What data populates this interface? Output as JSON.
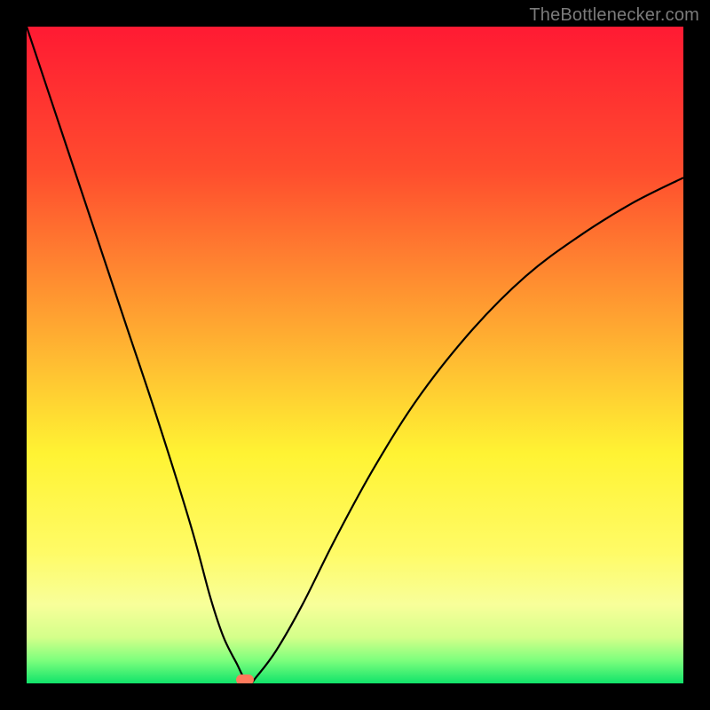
{
  "watermark": "TheBottlenecker.com",
  "chart_data": {
    "type": "line",
    "title": "",
    "xlabel": "",
    "ylabel": "",
    "xlim": [
      0,
      100
    ],
    "ylim": [
      0,
      100
    ],
    "gradient_stops": [
      {
        "offset": 0,
        "color": "#ff1a33"
      },
      {
        "offset": 0.22,
        "color": "#ff4d2e"
      },
      {
        "offset": 0.45,
        "color": "#ffa531"
      },
      {
        "offset": 0.65,
        "color": "#fff333"
      },
      {
        "offset": 0.8,
        "color": "#fffb66"
      },
      {
        "offset": 0.88,
        "color": "#f8ff9a"
      },
      {
        "offset": 0.93,
        "color": "#d4ff8a"
      },
      {
        "offset": 0.965,
        "color": "#7dff7d"
      },
      {
        "offset": 1.0,
        "color": "#11e36a"
      }
    ],
    "series": [
      {
        "name": "bottleneck-curve",
        "x": [
          0,
          5,
          10,
          15,
          20,
          25,
          28,
          30,
          32,
          33,
          34,
          35,
          38,
          42,
          47,
          53,
          60,
          68,
          76,
          84,
          92,
          100
        ],
        "y": [
          100,
          85,
          70,
          55,
          40,
          24,
          13,
          7,
          3,
          1,
          0,
          1,
          5,
          12,
          22,
          33,
          44,
          54,
          62,
          68,
          73,
          77
        ]
      }
    ],
    "marker": {
      "x": 33.3,
      "y": 0.5,
      "color": "#ff7a5c"
    }
  }
}
